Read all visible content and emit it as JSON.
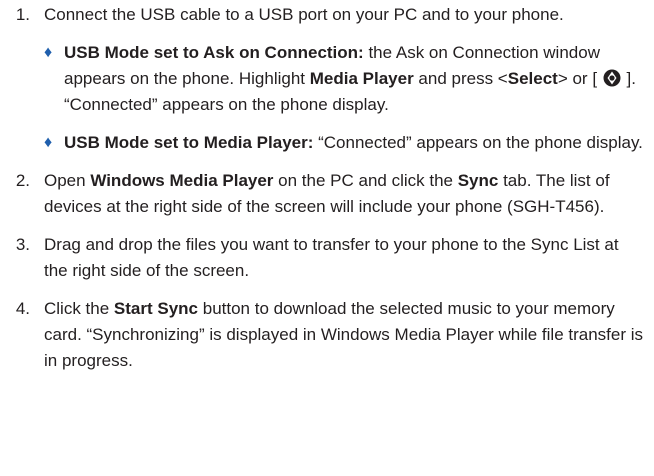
{
  "steps": [
    {
      "num": "1.",
      "text": "Connect the USB cable to a USB port on your PC and to your phone.",
      "bullets": [
        {
          "label": "USB Mode set to Ask on Connection:",
          "t1": " the Ask on Connection window appears on the phone. Highlight ",
          "b1": "Media Player",
          "t2": " and press <",
          "b2": "Select",
          "t3": "> or [ ",
          "icon": "nav-key-icon",
          "t4": " ]. “Connected” appears on the phone display."
        },
        {
          "label": "USB Mode set to Media Player:",
          "t1": " “Connected” appears on the phone display."
        }
      ]
    },
    {
      "num": "2.",
      "t1": "Open ",
      "b1": "Windows Media Player",
      "t2": " on the PC and click the ",
      "b2": "Sync",
      "t3": " tab. The list of devices at the right side of the screen will include your phone (SGH-T456)."
    },
    {
      "num": "3.",
      "text": "Drag and drop the files you want to transfer to your phone to the Sync List at the right side of the screen."
    },
    {
      "num": "4.",
      "t1": "Click the ",
      "b1": "Start Sync",
      "t2": " button to download the selected music to your memory card. “Synchronizing” is displayed in Windows Media Player while file transfer is in progress."
    }
  ],
  "bullet_glyph": "♦",
  "colors": {
    "text": "#231f20",
    "bullet": "#1f5fad"
  }
}
